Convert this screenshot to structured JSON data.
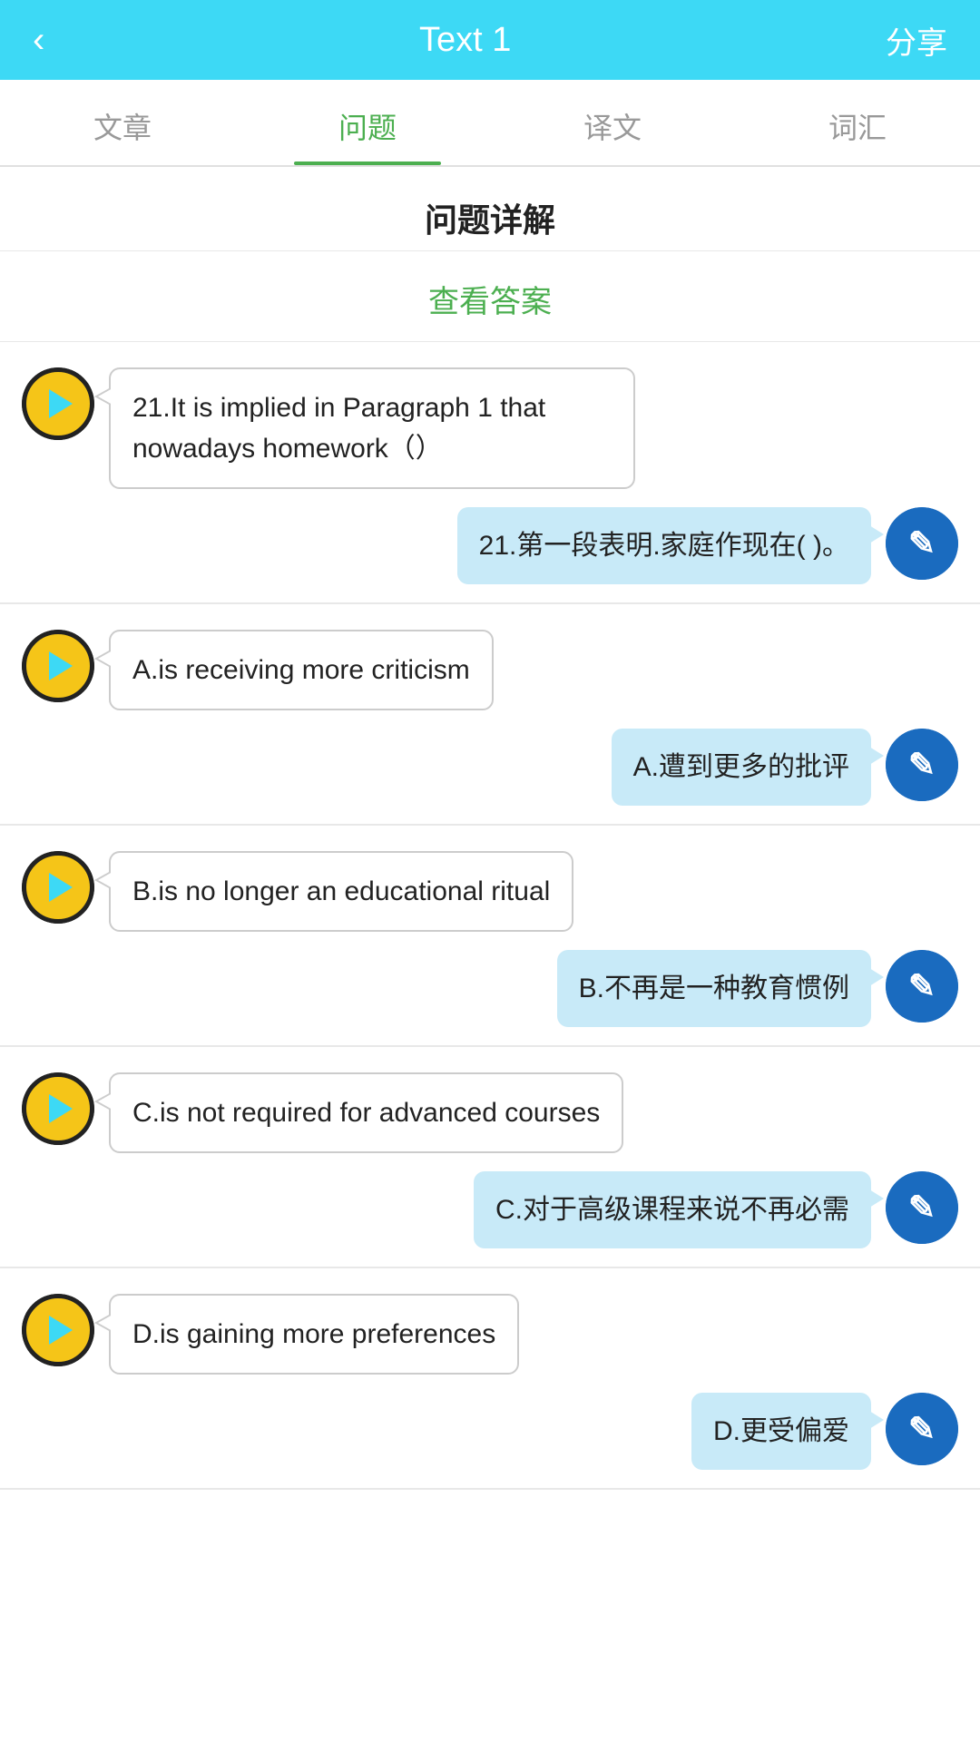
{
  "header": {
    "back_label": "‹",
    "title": "Text 1",
    "share_label": "分享"
  },
  "tabs": [
    {
      "id": "article",
      "label": "文章",
      "active": false
    },
    {
      "id": "questions",
      "label": "问题",
      "active": true
    },
    {
      "id": "translation",
      "label": "译文",
      "active": false
    },
    {
      "id": "vocabulary",
      "label": "词汇",
      "active": false
    }
  ],
  "section_title": "问题详解",
  "answer_link": "查看答案",
  "chats": [
    {
      "id": "q21",
      "bot_text": "21.It is implied in Paragraph 1 that nowadays homework（）",
      "user_text": "21.第一段表明.家庭作现在( )。"
    },
    {
      "id": "optA",
      "bot_text": "A.is receiving more criticism",
      "user_text": "A.遭到更多的批评"
    },
    {
      "id": "optB",
      "bot_text": "B.is no longer an educational ritual",
      "user_text": "B.不再是一种教育惯例"
    },
    {
      "id": "optC",
      "bot_text": "C.is not required for advanced courses",
      "user_text": "C.对于高级课程来说不再必需"
    },
    {
      "id": "optD",
      "bot_text": "D.is gaining more preferences",
      "user_text": "D.更受偏爱"
    }
  ],
  "colors": {
    "header_bg": "#3DD9F5",
    "active_tab": "#4CAF50",
    "user_bubble": "#C8EAF8",
    "answer_green": "#4CAF50"
  }
}
